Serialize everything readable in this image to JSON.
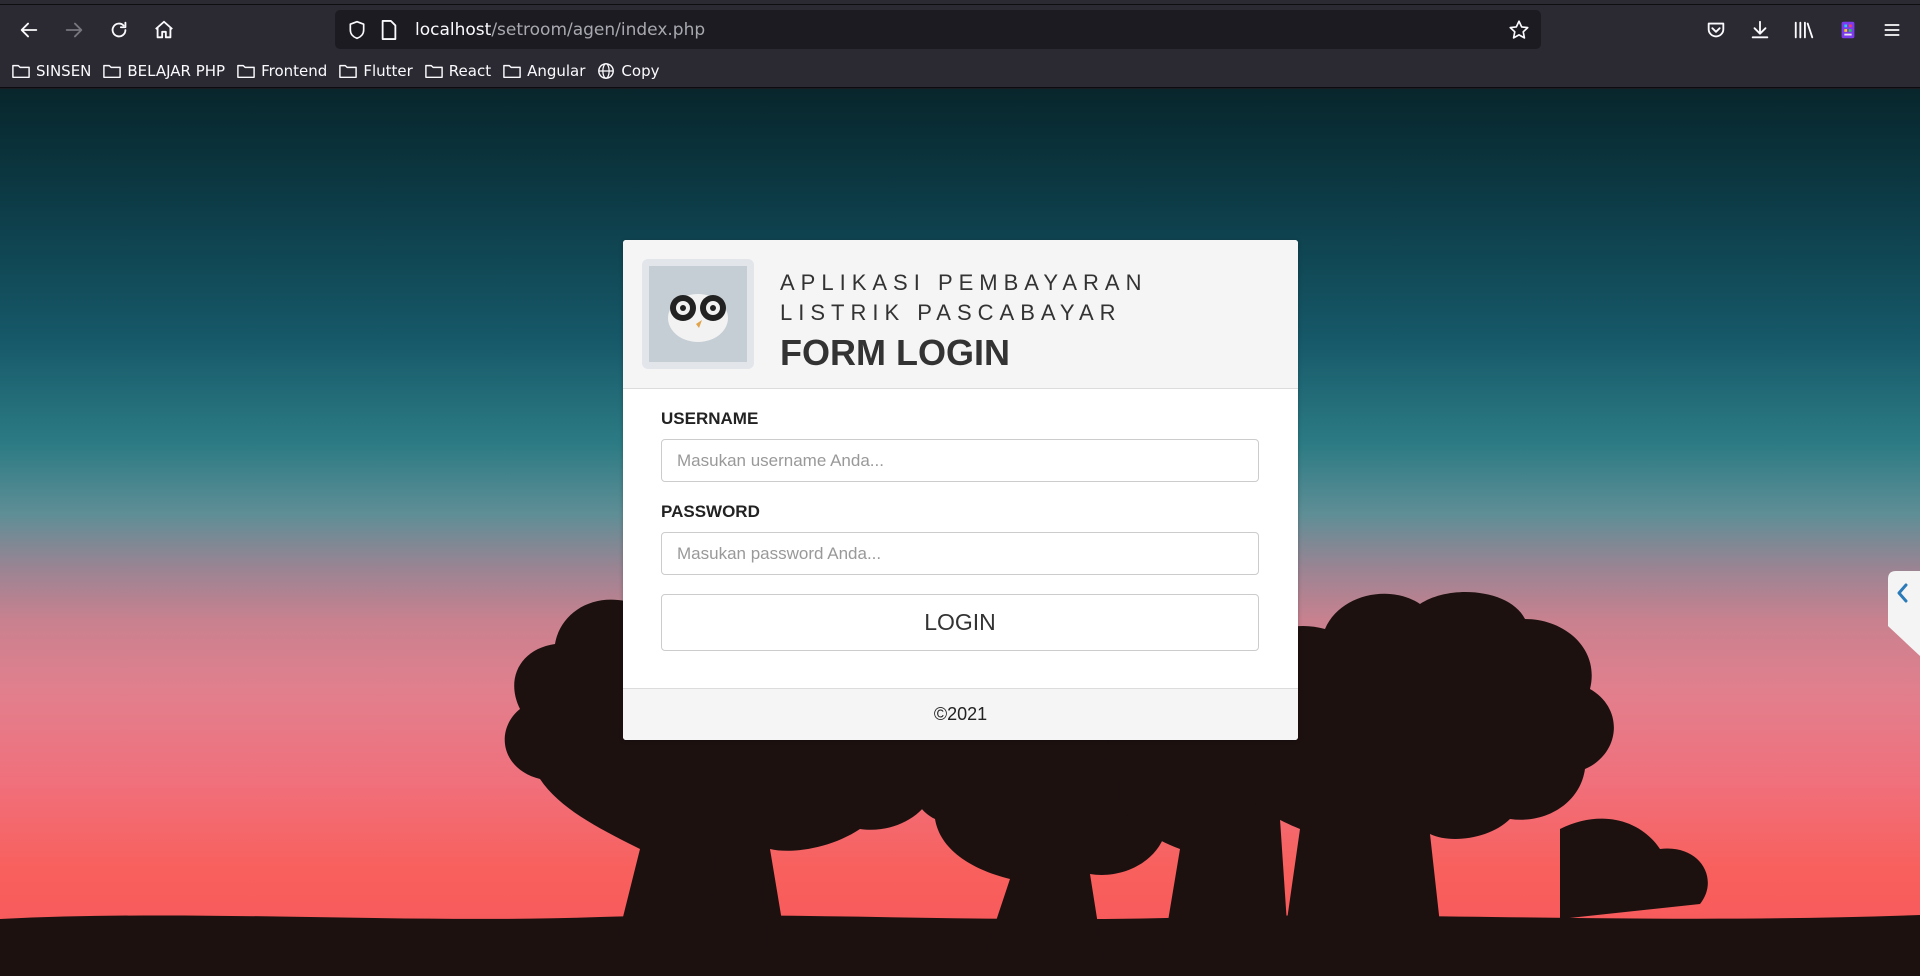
{
  "browser": {
    "url_host": "localhost",
    "url_path": "/setroom/agen/index.php",
    "bookmarks": [
      {
        "label": "SINSEN",
        "icon": "folder-icon"
      },
      {
        "label": "BELAJAR PHP",
        "icon": "folder-icon"
      },
      {
        "label": "Frontend",
        "icon": "folder-icon"
      },
      {
        "label": "Flutter",
        "icon": "folder-icon"
      },
      {
        "label": "React",
        "icon": "folder-icon"
      },
      {
        "label": "Angular",
        "icon": "folder-icon"
      },
      {
        "label": "Copy",
        "icon": "globe-icon"
      }
    ]
  },
  "login": {
    "app_title_line1": "APLIKASI PEMBAYARAN",
    "app_title_line2": "LISTRIK PASCABAYAR",
    "form_title": "FORM LOGIN",
    "username_label": "USERNAME",
    "username_placeholder": "Masukan username Anda...",
    "password_label": "PASSWORD",
    "password_placeholder": "Masukan password Anda...",
    "login_button": "LOGIN",
    "footer": "©2021"
  },
  "colors": {
    "browser_chrome": "#2b2a33",
    "url_field": "#1c1b22",
    "card_header_bg": "#f5f5f5",
    "side_tab_chevron": "#2b7bb9"
  }
}
